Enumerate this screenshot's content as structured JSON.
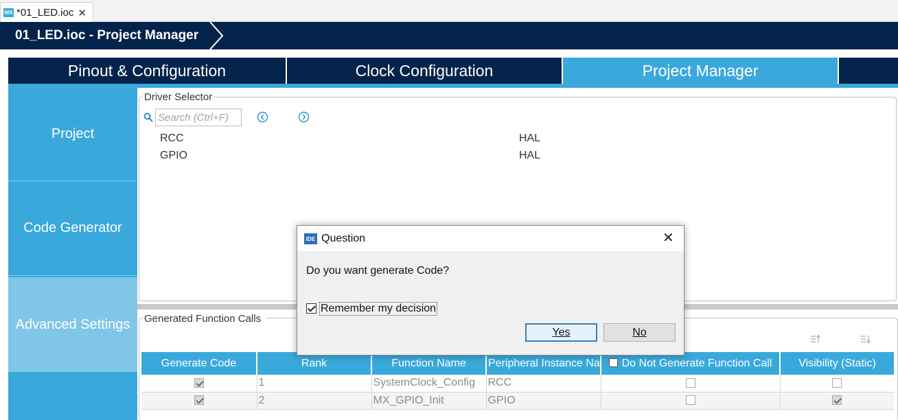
{
  "editor_tab": {
    "badge": "MX",
    "label": "*01_LED.ioc",
    "close": "✕"
  },
  "header": {
    "title": "01_LED.ioc - Project Manager"
  },
  "main_tabs": [
    {
      "label": "Pinout & Configuration",
      "active": false
    },
    {
      "label": "Clock Configuration",
      "active": false
    },
    {
      "label": "Project Manager",
      "active": true
    }
  ],
  "left_nav": [
    {
      "label": "Project",
      "active": false
    },
    {
      "label": "Code Generator",
      "active": false
    },
    {
      "label": "Advanced Settings",
      "active": true
    }
  ],
  "driver_selector": {
    "legend": "Driver Selector",
    "search_placeholder": "Search (Ctrl+F)",
    "rows": [
      {
        "peripheral": "RCC",
        "driver": "HAL"
      },
      {
        "peripheral": "GPIO",
        "driver": "HAL"
      }
    ]
  },
  "generated_calls": {
    "legend": "Generated Function Calls",
    "columns": {
      "generate_code": "Generate Code",
      "rank": "Rank",
      "function_name": "Function Name",
      "peripheral": "Peripheral Instance Na...",
      "do_not_generate": "Do Not Generate Function Call",
      "visibility": "Visibility (Static)"
    },
    "rows": [
      {
        "generate_code": true,
        "rank": "1",
        "function_name": "SystemClock_Config",
        "peripheral": "RCC",
        "do_not_generate": false,
        "visibility": false
      },
      {
        "generate_code": true,
        "rank": "2",
        "function_name": "MX_GPIO_Init",
        "peripheral": "GPIO",
        "do_not_generate": false,
        "visibility": true
      }
    ]
  },
  "dialog": {
    "badge": "IDE",
    "title": "Question",
    "close": "✕",
    "message": "Do you want generate Code?",
    "remember_label": "Remember my decision",
    "remember_checked": true,
    "yes_label": "Yes",
    "no_label": "No"
  },
  "colors": {
    "navy": "#03234b",
    "accent": "#39a9dc",
    "nav_active": "#80c6e8"
  }
}
